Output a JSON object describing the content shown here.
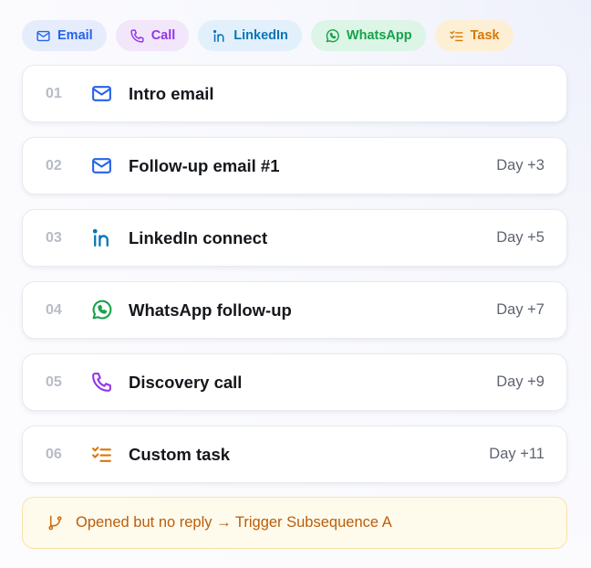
{
  "channels": [
    {
      "label": "Email",
      "icon": "mail-icon",
      "color": "#2563eb",
      "bg": "#e5ecfb"
    },
    {
      "label": "Call",
      "icon": "phone-icon",
      "color": "#9333ea",
      "bg": "#f2e6fb"
    },
    {
      "label": "LinkedIn",
      "icon": "linkedin-icon",
      "color": "#0a75b8",
      "bg": "#e2f0fb"
    },
    {
      "label": "WhatsApp",
      "icon": "whatsapp-icon",
      "color": "#16a34a",
      "bg": "#dcf5e6"
    },
    {
      "label": "Task",
      "icon": "checklist-icon",
      "color": "#d97706",
      "bg": "#fdefd4"
    }
  ],
  "steps": [
    {
      "num": "01",
      "title": "Intro email",
      "day": "",
      "icon": "mail-icon"
    },
    {
      "num": "02",
      "title": "Follow-up email #1",
      "day": "Day +3",
      "icon": "mail-icon"
    },
    {
      "num": "03",
      "title": "LinkedIn connect",
      "day": "Day +5",
      "icon": "linkedin-icon"
    },
    {
      "num": "04",
      "title": "WhatsApp follow-up",
      "day": "Day +7",
      "icon": "whatsapp-icon"
    },
    {
      "num": "05",
      "title": "Discovery call",
      "day": "Day +9",
      "icon": "phone-icon"
    },
    {
      "num": "06",
      "title": "Custom task",
      "day": "Day +11",
      "icon": "checklist-icon"
    }
  ],
  "trigger": {
    "text": "Opened but no reply → Trigger Subsequence A",
    "icon": "branch-icon",
    "color": "#b95d0c"
  }
}
